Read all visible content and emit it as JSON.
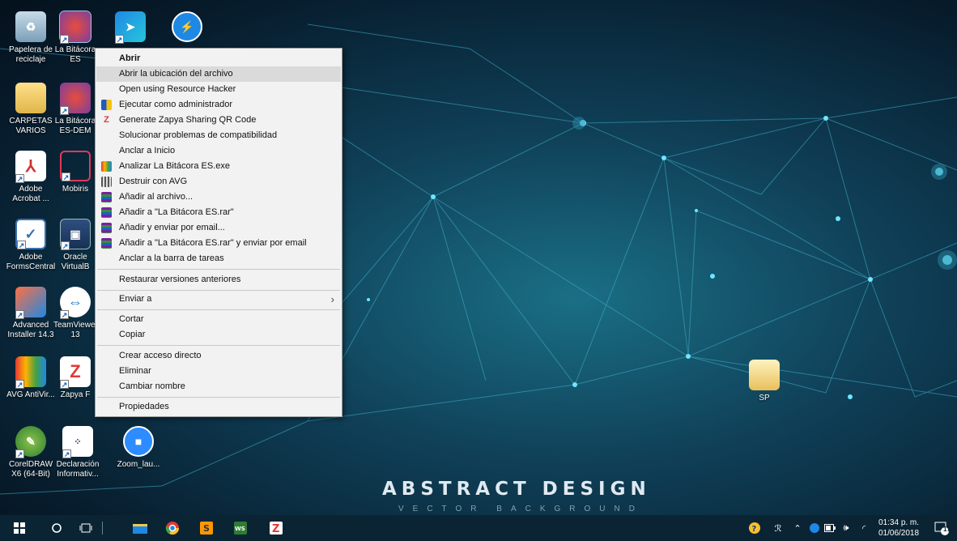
{
  "desktop": {
    "brand_title": "ABSTRACT DESIGN",
    "brand_subtitle": "VECTOR BACKGROUND",
    "icons": [
      {
        "label": "Papelera de reciclaje",
        "icon": "recycle-bin-icon"
      },
      {
        "label": "La Bitácora ES",
        "icon": "la-bitacora-icon"
      },
      {
        "label": "",
        "icon": "sharing-app-icon"
      },
      {
        "label": "",
        "icon": "lightning-app-icon"
      },
      {
        "label": "CARPETAS VARIOS",
        "icon": "folder-icon"
      },
      {
        "label": "La Bitácora ES-DEM",
        "icon": "la-bitacora-demo-icon"
      },
      {
        "label": "Adobe Acrobat ...",
        "icon": "adobe-acrobat-icon"
      },
      {
        "label": "Mobiris",
        "icon": "mobiris-icon"
      },
      {
        "label": "Adobe FormsCentral",
        "icon": "adobe-formscentral-icon"
      },
      {
        "label": "Oracle VirtualB",
        "icon": "oracle-virtualbox-icon"
      },
      {
        "label": "Advanced Installer 14.3",
        "icon": "advanced-installer-icon"
      },
      {
        "label": "TeamViewer 13",
        "icon": "teamviewer-icon"
      },
      {
        "label": "AVG AntiVir...",
        "icon": "avg-antivirus-icon"
      },
      {
        "label": "Zapya F",
        "icon": "zapya-icon"
      },
      {
        "label": "CorelDRAW X6 (64-Bit)",
        "icon": "coreldraw-icon"
      },
      {
        "label": "Declaración Informativ...",
        "icon": "sat-declaracion-icon"
      },
      {
        "label": "Zoom_lau...",
        "icon": "zoom-icon"
      },
      {
        "label": "SP",
        "icon": "folder-sp-icon"
      }
    ]
  },
  "context_menu": {
    "items": [
      {
        "label": "Abrir",
        "bold": true
      },
      {
        "label": "Abrir la ubicación del archivo",
        "highlighted": true
      },
      {
        "label": "Open using Resource Hacker"
      },
      {
        "label": "Ejecutar como administrador",
        "icon": "uac-shield-icon"
      },
      {
        "label": "Generate Zapya Sharing QR Code",
        "icon": "zapya-small-icon"
      },
      {
        "label": "Solucionar problemas de compatibilidad"
      },
      {
        "label": "Anclar a Inicio"
      },
      {
        "label": "Analizar La Bitácora ES.exe",
        "icon": "avg-small-icon"
      },
      {
        "label": "Destruir con AVG",
        "icon": "shredder-icon"
      },
      {
        "label": "Añadir al archivo...",
        "icon": "winrar-icon"
      },
      {
        "label": "Añadir a \"La Bitácora ES.rar\"",
        "icon": "winrar-icon"
      },
      {
        "label": "Añadir y enviar por email...",
        "icon": "winrar-icon"
      },
      {
        "label": "Añadir a \"La Bitácora ES.rar\" y enviar por email",
        "icon": "winrar-icon"
      },
      {
        "label": "Anclar a la barra de tareas"
      },
      {
        "label": "Restaurar versiones anteriores"
      },
      {
        "label": "Enviar a",
        "submenu": true
      },
      {
        "label": "Cortar"
      },
      {
        "label": "Copiar"
      },
      {
        "label": "Crear acceso directo"
      },
      {
        "label": "Eliminar"
      },
      {
        "label": "Cambiar nombre"
      },
      {
        "label": "Propiedades"
      }
    ]
  },
  "taskbar": {
    "time": "01:34 p. m.",
    "date": "01/06/2018",
    "notification_count": "17",
    "apps": [
      "start-icon",
      "search-icon",
      "task-view-icon",
      "file-explorer-icon",
      "chrome-icon",
      "sublime-text-icon",
      "wps-icon",
      "zapya-taskbar-icon"
    ]
  },
  "colors": {
    "menu_bg": "#f2f2f2",
    "menu_highlight": "#dadada",
    "taskbar_bg": "#0b2434",
    "wallpaper_dark": "#071c2c",
    "wallpaper_accent": "#26c6e6"
  }
}
